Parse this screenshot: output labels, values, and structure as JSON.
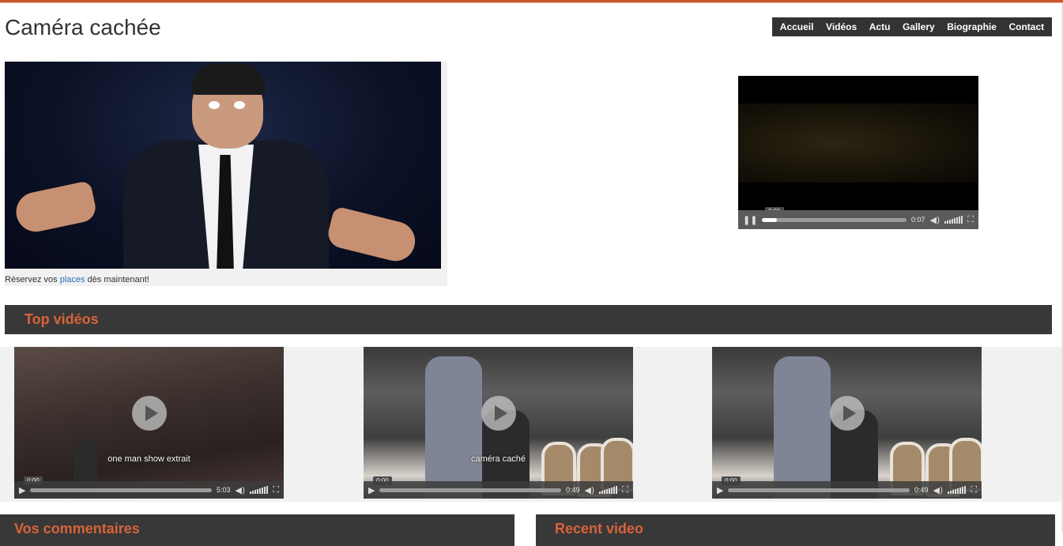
{
  "site": {
    "title": "Caméra cachée",
    "accent_color": "#d9633a"
  },
  "nav": {
    "items": [
      "Accueil",
      "Vidéos",
      "Actu",
      "Gallery",
      "Biographie",
      "Contact"
    ]
  },
  "hero": {
    "caption_before": "Réservez vos ",
    "caption_link": "places",
    "caption_after": " dès maintenant!"
  },
  "featured_video": {
    "tooltip_time": "0:01",
    "duration": "0:07",
    "progress": 0.1
  },
  "top_videos": {
    "heading": "Top vidéos",
    "items": [
      {
        "title": "one man show extrait",
        "tooltip_time": "0:00",
        "duration": "5:03",
        "progress": 0.0
      },
      {
        "title": "caméra caché",
        "tooltip_time": "0:00",
        "duration": "0:49",
        "progress": 0.0
      },
      {
        "title": "",
        "tooltip_time": "0:00",
        "duration": "0:49",
        "progress": 0.0
      }
    ]
  },
  "bottom": {
    "comments_heading": "Vos commentaires",
    "recent_heading": "Recent video"
  },
  "icons": {
    "pause": "pause-icon",
    "play": "play-icon",
    "volume": "volume-icon",
    "fullscreen": "fullscreen-icon"
  }
}
